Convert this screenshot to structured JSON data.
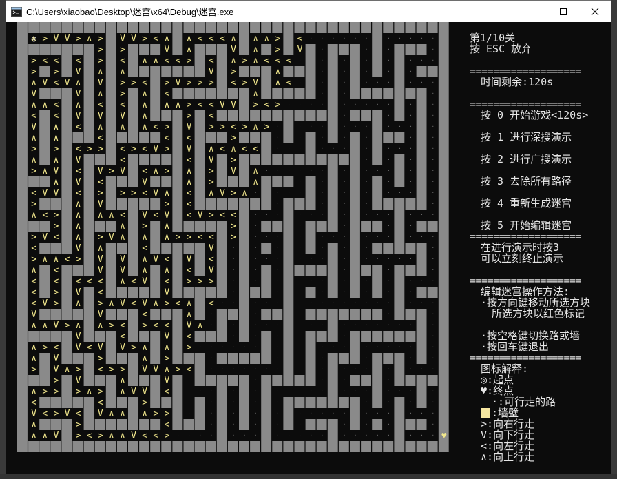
{
  "window": {
    "title": "C:\\Users\\xiaobao\\Desktop\\迷宫\\x64\\Debug\\迷宫.exe",
    "icon": "console-app-icon",
    "controls": [
      "minimize-icon",
      "maximize-icon",
      "close-icon"
    ]
  },
  "panel": {
    "level": "第1/10关",
    "esc_hint": "按 ESC 放弃",
    "separator": "===================",
    "time_left": "时间剩余:120s",
    "menu": [
      "按 0 开始游戏<120s>",
      "按 1 进行深搜演示",
      "按 2 进行广搜演示",
      "按 3 去除所有路径",
      "按 4 重新生成迷宫",
      "按 5 开始编辑迷宫"
    ],
    "demo_note_1": "在进行演示时按3",
    "demo_note_2": "可以立刻终止演示",
    "edit_title": "编辑迷宫操作方法:",
    "edit_1": "·按方向键移动所选方块",
    "edit_2": "所选方块以红色标记",
    "edit_3": "·按空格键切换路或墙",
    "edit_4": "·按回车键退出",
    "legend_title": "图标解释:",
    "legend": [
      {
        "symbol": "◎:",
        "text": "起点"
      },
      {
        "symbol": "♥:",
        "text": "终点"
      },
      {
        "symbol": "·:",
        "text": "可行走的路"
      },
      {
        "symbol": "",
        "text": "墙壁"
      },
      {
        "symbol": ">:",
        "text": "向右行走"
      },
      {
        "symbol": "V:",
        "text": "向下行走"
      },
      {
        "symbol": "<:",
        "text": "向左行走"
      },
      {
        "symbol": "∧:",
        "text": "向上行走"
      }
    ]
  },
  "colors": {
    "wall": "#8a8a8a",
    "floor": "#0c0c0c",
    "path_arrow": "#f0e68c",
    "text": "#e6e6e6",
    "wall_swatch": "#f5e6a0"
  },
  "maze": {
    "cols": 39,
    "rows": 39,
    "start_symbol": "◎",
    "end_symbol": "♥"
  }
}
